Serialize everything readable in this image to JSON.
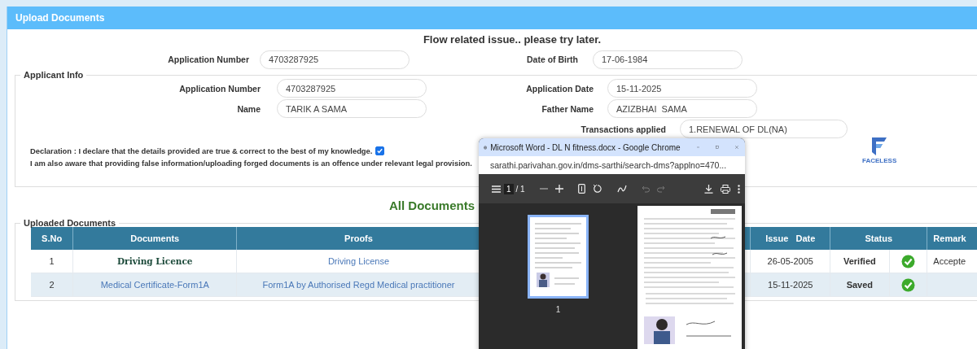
{
  "header": {
    "title": "Upload Documents"
  },
  "message": "Flow related issue.. please try later.",
  "top_fields": [
    {
      "label": "Application Number",
      "value": "4703287925"
    },
    {
      "label": "Date of Birth",
      "value": "17-06-1984"
    }
  ],
  "applicant_info": {
    "legend": "Applicant Info",
    "fields": [
      {
        "label": "Application Number",
        "value": "4703287925"
      },
      {
        "label": "Application Date",
        "value": "15-11-2025"
      },
      {
        "label": "Name",
        "value": "TARIK A SAMA"
      },
      {
        "label": "Father Name",
        "value": "AZIZBHAI  SAMA"
      }
    ],
    "transactions": {
      "label": "Transactions applied",
      "value": "1.RENEWAL OF DL(NA)"
    },
    "declaration": {
      "text": "Declaration : I declare that the details provided are true & correct to the best of my knowledge.",
      "checked": true
    },
    "notice": "I am also aware that providing false information/uploading forged documents is an offence under relevant legal provision.",
    "logo_text": "FACELESS"
  },
  "documents_heading": "All Documents",
  "uploaded": {
    "legend": "Uploaded Documents",
    "columns": [
      "S.No",
      "Documents",
      "Proofs",
      "Issue   Date",
      "Status",
      "Remark"
    ],
    "rows": [
      {
        "sno": "1",
        "document": "Driving Licence",
        "kind": "text",
        "proof": "Driving License",
        "issue_date": "26-05-2005",
        "status": "Verified",
        "remarks": "Accepte"
      },
      {
        "sno": "2",
        "document": "Medical Certificate-Form1A",
        "kind": "link",
        "proof": "Form1A by Authorised Regd Medical practitioner",
        "issue_date": "15-11-2025",
        "status": "Saved"
      }
    ]
  },
  "popup": {
    "title": "Microsoft Word - DL N fitness.docx - Google Chrome",
    "url": "sarathi.parivahan.gov.in/dms-sarthi/search-dms?applno=470...",
    "page": "1",
    "page_total": "/ 1",
    "thumb_label": "1"
  }
}
